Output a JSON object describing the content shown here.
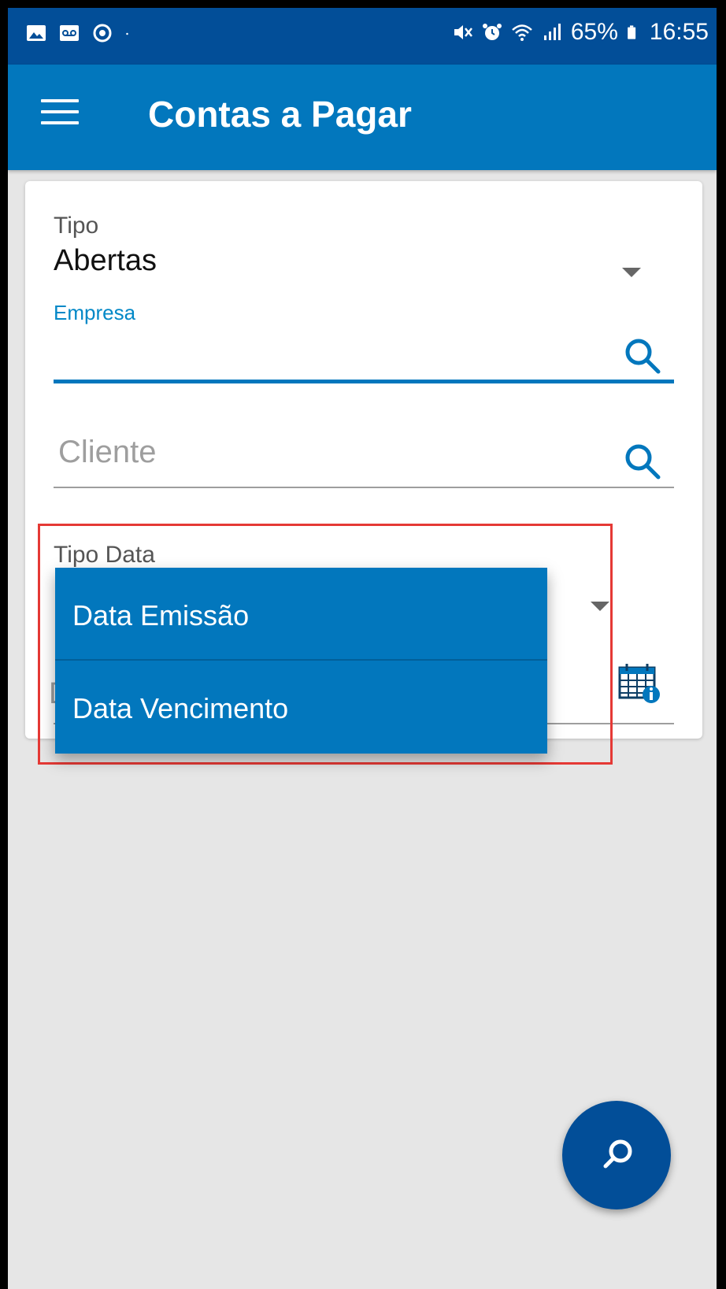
{
  "status_bar": {
    "battery": "65%",
    "time": "16:55",
    "left_icons": [
      "image-icon",
      "voicemail-icon",
      "sync-icon",
      "dot-icon"
    ],
    "right_icons": [
      "mute-icon",
      "alarm-icon",
      "wifi-icon",
      "signal-icon",
      "battery-icon"
    ]
  },
  "app_bar": {
    "title": "Contas a Pagar",
    "menu_icon": "menu-icon"
  },
  "form": {
    "tipo": {
      "label": "Tipo",
      "value": "Abertas"
    },
    "empresa": {
      "label": "Empresa",
      "value": ""
    },
    "cliente": {
      "placeholder": "Cliente",
      "value": ""
    },
    "tipo_data": {
      "label": "Tipo Data"
    },
    "obscured_field_initial": "D"
  },
  "dropdown": {
    "options": [
      {
        "label": "Data Emissão"
      },
      {
        "label": "Data Vencimento"
      }
    ]
  },
  "colors": {
    "status_bar": "#024e98",
    "app_bar": "#0277bd",
    "highlight": "#e53935",
    "fab": "#024e98"
  }
}
